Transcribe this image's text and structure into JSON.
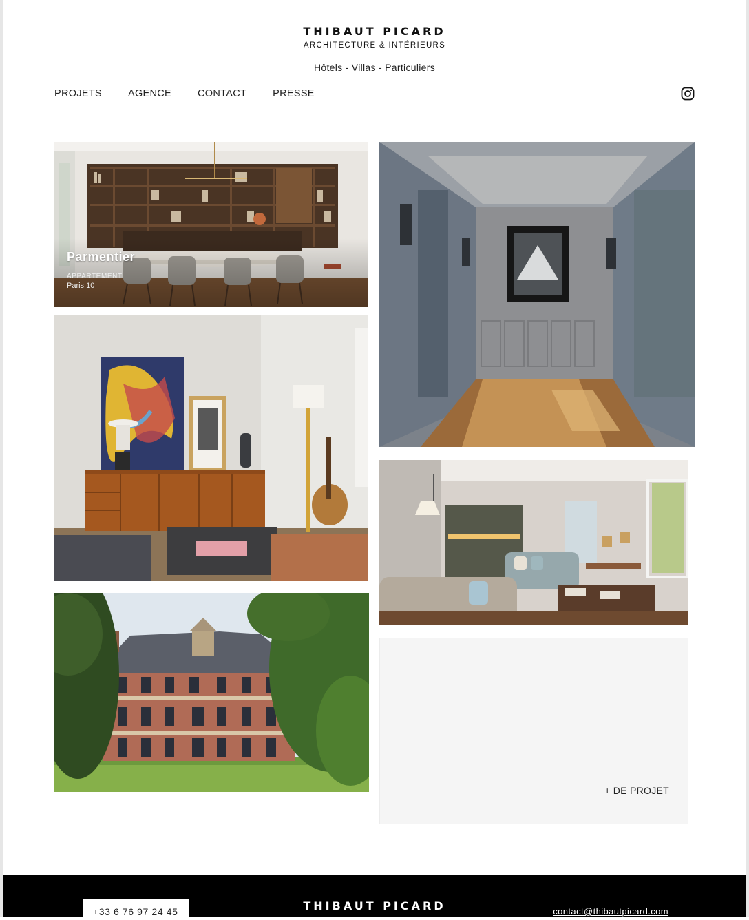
{
  "header": {
    "brand_name": "THIBAUT PICARD",
    "brand_subtitle": "ARCHITECTURE & INTÉRIEURS",
    "tagline": "Hôtels - Villas - Particuliers"
  },
  "nav": {
    "items": [
      {
        "label": "PROJETS"
      },
      {
        "label": "AGENCE"
      },
      {
        "label": "CONTACT"
      },
      {
        "label": "PRESSE"
      }
    ],
    "social_icon": "instagram-icon"
  },
  "projects": {
    "featured": {
      "title": "Parmentier",
      "type": "APPARTEMENT",
      "location": "Paris 10"
    },
    "more_label": "+ DE PROJET"
  },
  "footer": {
    "phone": "+33 6 76 97 24 45",
    "brand_name": "THIBAUT PICARD",
    "email": "contact@thibautpicard.com"
  },
  "colors": {
    "background": "#ffffff",
    "footer": "#000000",
    "more_tile": "#f5f5f5"
  }
}
